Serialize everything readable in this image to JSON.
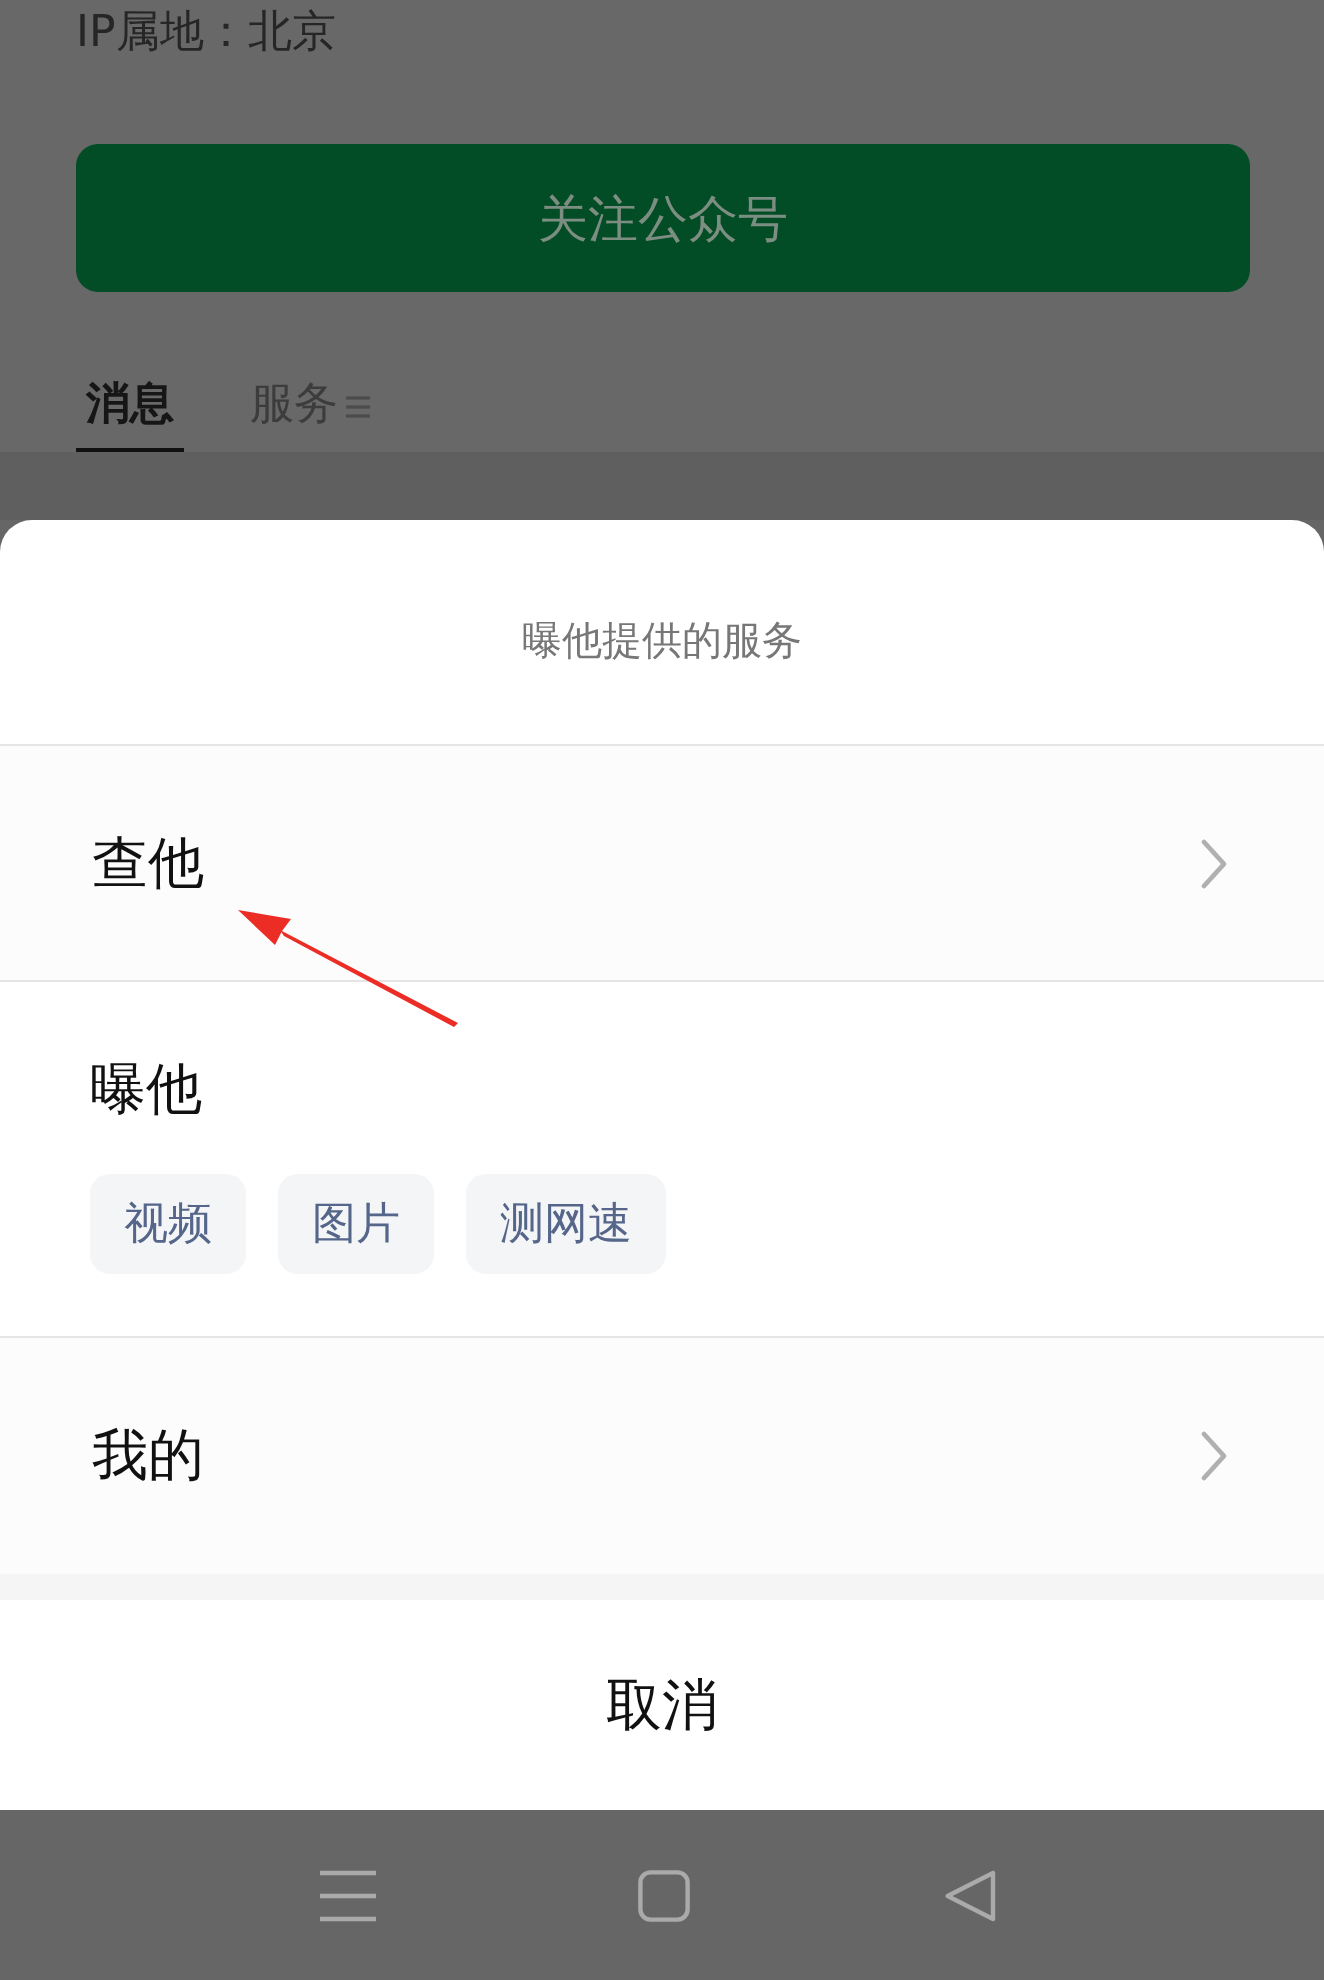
{
  "background_page": {
    "ip_location": "IP属地：北京",
    "follow_button": "关注公众号",
    "tabs": [
      {
        "label": "消息",
        "selected": true,
        "has_menu": false
      },
      {
        "label": "服务",
        "selected": false,
        "has_menu": true
      }
    ]
  },
  "sheet": {
    "title": "曝他提供的服务",
    "rows": [
      {
        "kind": "link",
        "label": "查他"
      },
      {
        "kind": "chips",
        "label": "曝他",
        "chips": [
          "视频",
          "图片",
          "测网速"
        ]
      },
      {
        "kind": "link",
        "label": "我的"
      }
    ],
    "cancel": "取消"
  }
}
